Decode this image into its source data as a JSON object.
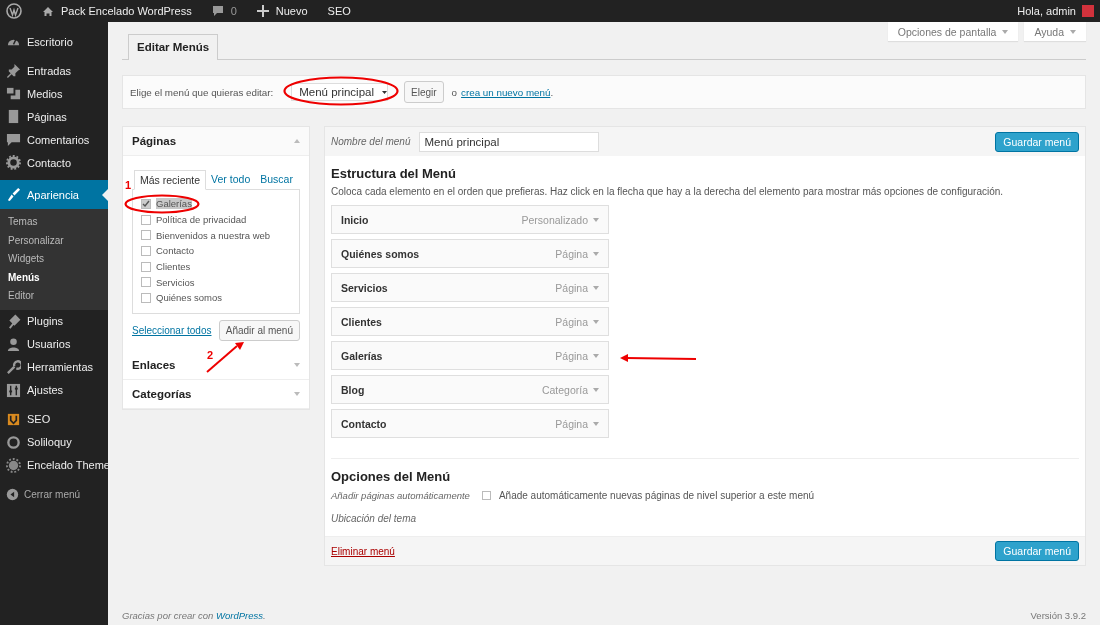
{
  "admin_bar": {
    "site_title": "Pack Encelado WordPress",
    "comments_count": "0",
    "new_label": "Nuevo",
    "seo_label": "SEO",
    "greeting": "Hola, admin"
  },
  "screen_buttons": [
    {
      "label": "Opciones de pantalla"
    },
    {
      "label": "Ayuda"
    }
  ],
  "sidebar": {
    "groups": [
      {
        "items": [
          {
            "kind": "menu",
            "label": "Escritorio",
            "selected": false
          }
        ]
      },
      {
        "items": [
          {
            "kind": "menu",
            "label": "Entradas",
            "selected": false
          },
          {
            "kind": "menu",
            "label": "Medios",
            "selected": false
          },
          {
            "kind": "menu",
            "label": "Páginas",
            "selected": false
          },
          {
            "kind": "menu",
            "label": "Comentarios",
            "selected": false
          },
          {
            "kind": "menu",
            "label": "Contacto",
            "selected": false
          }
        ]
      },
      {
        "items": [
          {
            "kind": "menu",
            "label": "Apariencia",
            "selected": true,
            "children": [
              {
                "label": "Temas",
                "selected": false
              },
              {
                "label": "Personalizar",
                "selected": false
              },
              {
                "label": "Widgets",
                "selected": false
              },
              {
                "label": "Menús",
                "selected": true
              },
              {
                "label": "Editor",
                "selected": false
              }
            ]
          },
          {
            "kind": "menu",
            "label": "Plugins",
            "selected": false
          },
          {
            "kind": "menu",
            "label": "Usuarios",
            "selected": false
          },
          {
            "kind": "menu",
            "label": "Herramientas",
            "selected": false
          },
          {
            "kind": "menu",
            "label": "Ajustes",
            "selected": false
          }
        ]
      },
      {
        "items": [
          {
            "kind": "menu",
            "label": "SEO",
            "selected": false
          },
          {
            "kind": "menu",
            "label": "Soliloquy",
            "selected": false
          },
          {
            "kind": "menu",
            "label": "Encelado Theme",
            "selected": false
          }
        ]
      },
      {
        "items": [
          {
            "kind": "collapse",
            "label": "Cerrar menú",
            "selected": false
          }
        ]
      }
    ]
  },
  "tabs": [
    {
      "label": "Editar Menús",
      "selected": true
    }
  ],
  "menu_select": {
    "prompt": "Elige el menú que quieras editar:",
    "value": "Menú principal",
    "button": "Elegir",
    "or_text": "o",
    "create_link": "crea un nuevo menú",
    "after": "."
  },
  "pages_box": {
    "title": "Páginas",
    "expanded": true,
    "tabs": [
      {
        "label": "Más reciente",
        "selected": true
      },
      {
        "label": "Ver todo",
        "selected": false
      },
      {
        "label": "Buscar",
        "selected": false
      }
    ],
    "pages": [
      {
        "label": "Galerías",
        "checked": true
      },
      {
        "label": "Política de privacidad",
        "checked": false
      },
      {
        "label": "Bienvenidos a nuestra web",
        "checked": false
      },
      {
        "label": "Contacto",
        "checked": false
      },
      {
        "label": "Clientes",
        "checked": false
      },
      {
        "label": "Servicios",
        "checked": false
      },
      {
        "label": "Quiénes somos",
        "checked": false
      }
    ],
    "select_all": "Seleccionar todos",
    "add_button": "Añadir al menú"
  },
  "other_boxes": [
    {
      "title": "Enlaces",
      "expanded": false
    },
    {
      "title": "Categorías",
      "expanded": false
    }
  ],
  "menu_editor": {
    "name_label": "Nombre del menú",
    "name_value": "Menú principal",
    "save_button": "Guardar menú",
    "structure_title": "Estructura del Menú",
    "structure_hint": "Coloca cada elemento en el orden que prefieras. Haz click en la flecha que hay a la derecha del elemento para mostrar más opciones de configuración.",
    "items": [
      {
        "title": "Inicio",
        "type": "Personalizado"
      },
      {
        "title": "Quiénes somos",
        "type": "Página"
      },
      {
        "title": "Servicios",
        "type": "Página"
      },
      {
        "title": "Clientes",
        "type": "Página"
      },
      {
        "title": "Galerías",
        "type": "Página"
      },
      {
        "title": "Blog",
        "type": "Categoría"
      },
      {
        "title": "Contacto",
        "type": "Página"
      }
    ],
    "options_title": "Opciones del Menú",
    "auto_add_label": "Añadir páginas automáticamente",
    "auto_add_text": "Añade automáticamente nuevas páginas de nivel superior a este menú",
    "auto_add_checked": false,
    "location_label": "Ubicación del tema",
    "delete_link": "Eliminar menú",
    "save_button_bottom": "Guardar menú"
  },
  "footer": {
    "thanks": "Gracias por crear con",
    "link": "WordPress",
    "after": ".",
    "version": "Versión 3.9.2"
  },
  "annotations": [
    {
      "kind": "ellipse"
    },
    {
      "kind": "ellipse"
    },
    {
      "kind": "arrow"
    },
    {
      "kind": "arrow"
    },
    {
      "kind": "label",
      "text": "1"
    },
    {
      "kind": "label",
      "text": "2"
    }
  ]
}
